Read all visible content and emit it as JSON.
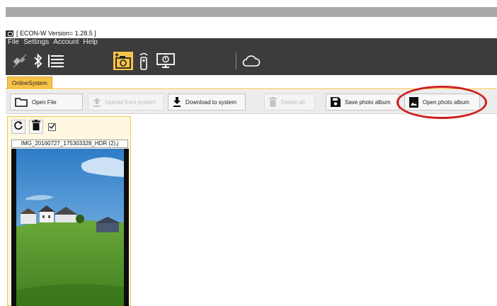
{
  "window": {
    "title": "[ ECON-W Version= 1.28.5 ]"
  },
  "menu": {
    "items": [
      "File",
      "Settings",
      "Account",
      "Help"
    ]
  },
  "iconbar": {
    "icons": [
      "connection-icon",
      "bluetooth-icon",
      "list-icon",
      "camera-add-icon",
      "remote-icon",
      "monitor-icon",
      "cloud-icon"
    ]
  },
  "tabs": {
    "active": "OnlineSystem"
  },
  "toolbar": {
    "open_file": "Open File",
    "upload": "Upload from system",
    "download": "Download to system",
    "delete_all": "Delete all",
    "save_album": "Save photo album",
    "open_album": "Open photo album"
  },
  "photo": {
    "filename": "IMG_20160727_175303328_HDR (2).j",
    "selected": true
  },
  "colors": {
    "chrome": "#3c3c3c",
    "tab": "#f8c349",
    "highlight": "#d11f1f"
  }
}
